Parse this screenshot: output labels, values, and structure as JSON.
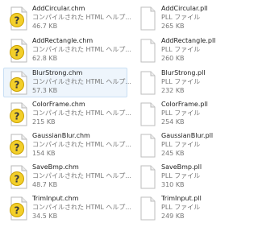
{
  "files_left": [
    {
      "name": "AddCircular.chm",
      "type": "コンパイルされた HTML ヘルプ...",
      "size": "46.7 KB",
      "icon": "chm-help-icon"
    },
    {
      "name": "AddRectangle.chm",
      "type": "コンパイルされた HTML ヘルプ...",
      "size": "62.8 KB",
      "icon": "chm-help-icon"
    },
    {
      "name": "BlurStrong.chm",
      "type": "コンパイルされた HTML ヘルプ...",
      "size": "57.3 KB",
      "icon": "chm-help-icon",
      "selected": true
    },
    {
      "name": "ColorFrame.chm",
      "type": "コンパイルされた HTML ヘルプ...",
      "size": "215 KB",
      "icon": "chm-help-icon"
    },
    {
      "name": "GaussianBlur.chm",
      "type": "コンパイルされた HTML ヘルプ...",
      "size": "154 KB",
      "icon": "chm-help-icon"
    },
    {
      "name": "SaveBmp.chm",
      "type": "コンパイルされた HTML ヘルプ...",
      "size": "48.7 KB",
      "icon": "chm-help-icon"
    },
    {
      "name": "TrimInput.chm",
      "type": "コンパイルされた HTML ヘルプ...",
      "size": "34.5 KB",
      "icon": "chm-help-icon"
    }
  ],
  "files_right": [
    {
      "name": "AddCircular.pll",
      "type": "PLL ファイル",
      "size": "265 KB",
      "icon": "blank-file-icon"
    },
    {
      "name": "AddRectangle.pll",
      "type": "PLL ファイル",
      "size": "260 KB",
      "icon": "blank-file-icon"
    },
    {
      "name": "BlurStrong.pll",
      "type": "PLL ファイル",
      "size": "232 KB",
      "icon": "blank-file-icon"
    },
    {
      "name": "ColorFrame.pll",
      "type": "PLL ファイル",
      "size": "254 KB",
      "icon": "blank-file-icon"
    },
    {
      "name": "GaussianBlur.pll",
      "type": "PLL ファイル",
      "size": "245 KB",
      "icon": "blank-file-icon"
    },
    {
      "name": "SaveBmp.pll",
      "type": "PLL ファイル",
      "size": "310 KB",
      "icon": "blank-file-icon"
    },
    {
      "name": "TrimInput.pll",
      "type": "PLL ファイル",
      "size": "249 KB",
      "icon": "blank-file-icon"
    }
  ],
  "colors": {
    "selection_bg": "#eef5fc",
    "selection_border": "#c9dff4",
    "name_text": "#1c1c1c",
    "detail_text": "#777777",
    "help_yellow": "#f3cf2a"
  }
}
